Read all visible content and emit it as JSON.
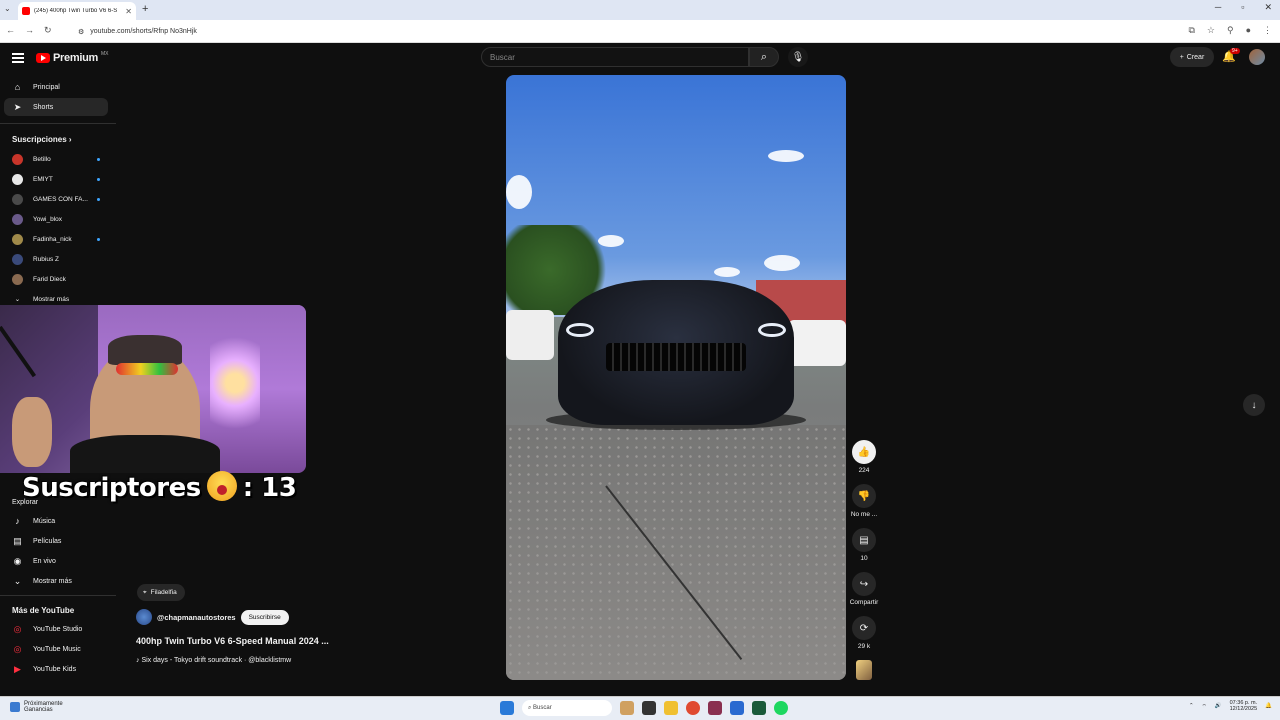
{
  "browser": {
    "tab_title": "(245) 400hp Twin Turbo V6 6-S",
    "url": "youtube.com/shorts/Rfnp No3nHjk",
    "icons": [
      "tab-menu-icon",
      "back-icon",
      "forward-icon",
      "reload-icon",
      "site-info-icon",
      "install-icon",
      "bookmark-star-icon",
      "extensions-icon",
      "profile-icon",
      "menu-dots-icon"
    ]
  },
  "header": {
    "logo_text": "Premium",
    "logo_region": "MX",
    "search_placeholder": "Buscar",
    "create_label": "Crear",
    "notif_badge": "9+"
  },
  "sidebar": {
    "nav": [
      {
        "label": "Principal",
        "icon": "home-icon"
      },
      {
        "label": "Shorts",
        "icon": "shorts-icon"
      }
    ],
    "subs_heading": "Suscripciones",
    "subscriptions": [
      {
        "label": "Betillo",
        "color": "#c8352a",
        "new": true
      },
      {
        "label": "EMIYT",
        "color": "#e8e8e8",
        "new": true
      },
      {
        "label": "GAMES CON FA...",
        "color": "#4a4a4a",
        "new": true
      },
      {
        "label": "Yowi_blox",
        "color": "#6a5a8a",
        "new": false
      },
      {
        "label": "Fadinha_nick",
        "color": "#a08a4a",
        "new": true
      },
      {
        "label": "Rubius Z",
        "color": "#3a4a7a",
        "new": false
      },
      {
        "label": "Farid Dieck",
        "color": "#8a6a50",
        "new": false
      }
    ],
    "show_more": "Mostrar más",
    "explore_heading": "Explorar",
    "explore": [
      {
        "label": "Música",
        "icon": "music-icon"
      },
      {
        "label": "Películas",
        "icon": "film-icon"
      },
      {
        "label": "En vivo",
        "icon": "live-icon"
      }
    ],
    "explore_more": "Mostrar más",
    "more_heading": "Más de YouTube",
    "more": [
      {
        "label": "YouTube Studio"
      },
      {
        "label": "YouTube Music"
      },
      {
        "label": "YouTube Kids"
      }
    ]
  },
  "overlay": {
    "subs_text": "Suscriptores",
    "subs_count": ": 13"
  },
  "video": {
    "location": "Filadelfia",
    "channel": "@chapmanautostores",
    "subscribe_label": "Suscribirse",
    "title": "400hp Twin Turbo V6 6-Speed Manual 2024 ...",
    "music": "Six days - Tokyo drift soundtrack · @blacklistmw"
  },
  "actions": {
    "likes": "224",
    "dislike_label": "No me ...",
    "comments": "10",
    "share_label": "Compartir",
    "remix": "29 k"
  },
  "taskbar": {
    "weather_line1": "Próximamente",
    "weather_line2": "Ganancias",
    "search_label": "Buscar",
    "time": "07:36 p. m.",
    "date": "12/12/2025"
  }
}
